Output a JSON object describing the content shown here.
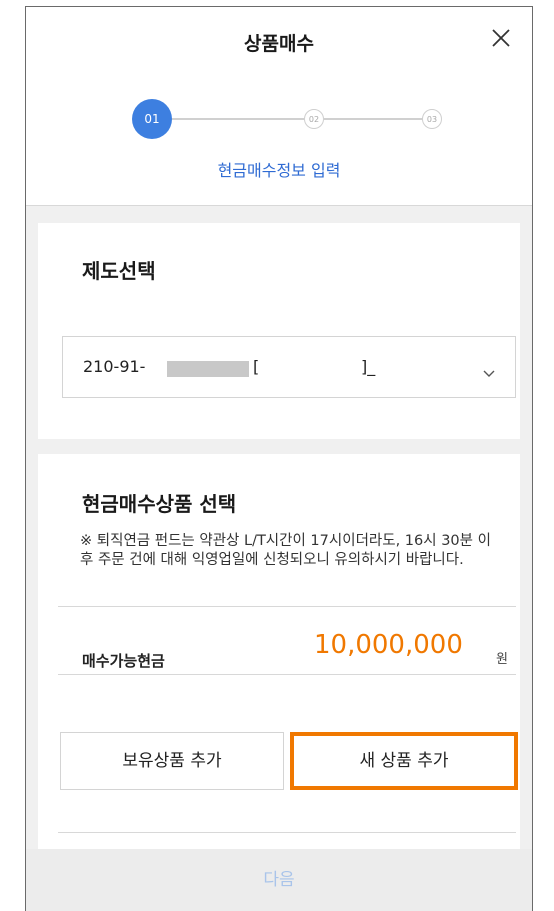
{
  "header": {
    "title": "상품매수",
    "steps": [
      "01",
      "02",
      "03"
    ],
    "current_step_label": "현금매수정보 입력"
  },
  "system_section": {
    "title": "제도선택",
    "account_select": {
      "prefix": "210-91-",
      "suffix": "[                    ]_"
    }
  },
  "product_section": {
    "title": "현금매수상품 선택",
    "notice": "※ 퇴직연금 펀드는 약관상 L/T시간이 17시이더라도, 16시 30분 이후 주문 건에 대해 익영업일에 신청되오니 유의하시기 바랍니다.",
    "cash_label": "매수가능현금",
    "cash_value": "10,000,000",
    "cash_unit": "원",
    "buttons": {
      "keep": "보유상품 추가",
      "new": "새 상품 추가"
    }
  },
  "footer": {
    "next_label": "다음"
  },
  "colors": {
    "accent_blue": "#3d7fe0",
    "highlight_orange": "#f07800"
  },
  "icons": [
    "close-icon",
    "chevron-down-icon"
  ]
}
